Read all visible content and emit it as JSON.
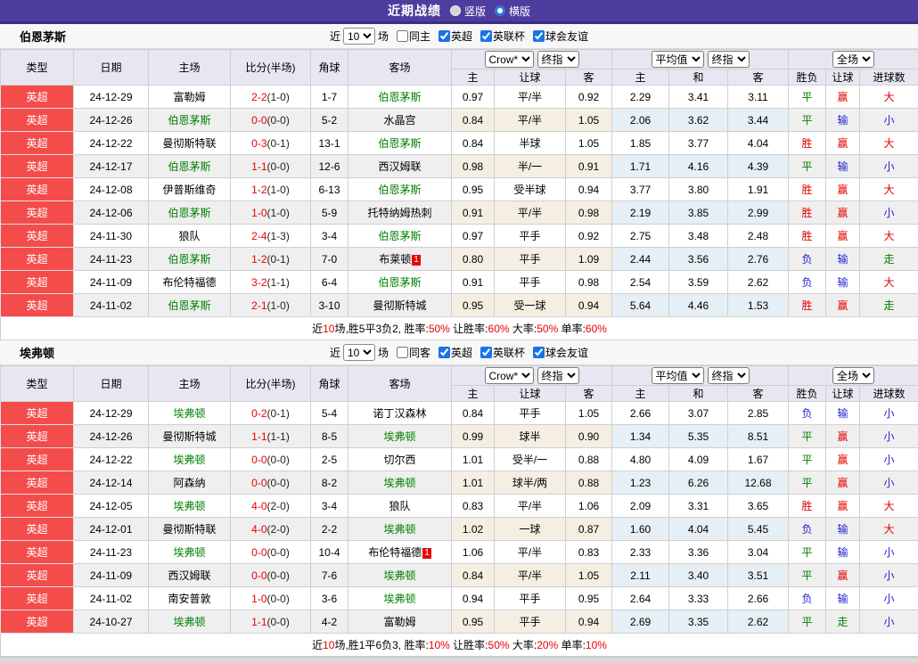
{
  "topbar": {
    "title": "近期战绩",
    "radios": [
      {
        "label": "竖版",
        "checked": false
      },
      {
        "label": "横版",
        "checked": true
      }
    ]
  },
  "table_headers": {
    "cols": [
      "类型",
      "日期",
      "主场",
      "比分(半场)",
      "角球",
      "客场"
    ],
    "odds_group": {
      "select1": "Crow*",
      "select2": "终指",
      "subcols": [
        "主",
        "让球",
        "客"
      ]
    },
    "avg_group": {
      "select1": "平均值",
      "select2": "终指",
      "subcols": [
        "主",
        "和",
        "客"
      ]
    },
    "result_group": {
      "select": "全场",
      "subcols": [
        "胜负",
        "让球",
        "进球数"
      ]
    }
  },
  "colors": {
    "win": "#e60000",
    "draw": "#008000",
    "lose": "#1f1fd0",
    "accent_purple": "#4e3d9e",
    "type_red": "#f44b4b",
    "team_green": "#008000"
  },
  "result_color_map": {
    "胜": "win",
    "平": "draw",
    "负": "lose",
    "赢": "win",
    "走": "draw",
    "输": "lose",
    "大": "win",
    "小": "lose"
  },
  "sections": [
    {
      "team": "伯恩茅斯",
      "filter": {
        "near": "近",
        "count": "10",
        "games": "场",
        "same": {
          "label": "同主",
          "checked": false
        },
        "leagues": [
          {
            "label": "英超",
            "checked": true
          },
          {
            "label": "英联杯",
            "checked": true
          },
          {
            "label": "球会友谊",
            "checked": true
          }
        ]
      },
      "rows": [
        {
          "ty": "英超",
          "dt": "24-12-29",
          "hm": "富勒姆",
          "hs": false,
          "sc": "2-2",
          "hf": "(1-0)",
          "cn": "1-7",
          "aw": "伯恩茅斯",
          "as": true,
          "ab": false,
          "o1": "0.97",
          "h": "平/半",
          "o2": "0.92",
          "a1": "2.29",
          "a2": "3.41",
          "a3": "3.11",
          "r1": "平",
          "r2": "赢",
          "r3": "大"
        },
        {
          "ty": "英超",
          "dt": "24-12-26",
          "hm": "伯恩茅斯",
          "hs": true,
          "sc": "0-0",
          "hf": "(0-0)",
          "cn": "5-2",
          "aw": "水晶宫",
          "as": false,
          "ab": false,
          "o1": "0.84",
          "h": "平/半",
          "o2": "1.05",
          "a1": "2.06",
          "a2": "3.62",
          "a3": "3.44",
          "r1": "平",
          "r2": "输",
          "r3": "小"
        },
        {
          "ty": "英超",
          "dt": "24-12-22",
          "hm": "曼彻斯特联",
          "hs": false,
          "sc": "0-3",
          "hf": "(0-1)",
          "cn": "13-1",
          "aw": "伯恩茅斯",
          "as": true,
          "ab": false,
          "o1": "0.84",
          "h": "半球",
          "o2": "1.05",
          "a1": "1.85",
          "a2": "3.77",
          "a3": "4.04",
          "r1": "胜",
          "r2": "赢",
          "r3": "大"
        },
        {
          "ty": "英超",
          "dt": "24-12-17",
          "hm": "伯恩茅斯",
          "hs": true,
          "sc": "1-1",
          "hf": "(0-0)",
          "cn": "12-6",
          "aw": "西汉姆联",
          "as": false,
          "ab": false,
          "o1": "0.98",
          "h": "半/一",
          "o2": "0.91",
          "a1": "1.71",
          "a2": "4.16",
          "a3": "4.39",
          "r1": "平",
          "r2": "输",
          "r3": "小"
        },
        {
          "ty": "英超",
          "dt": "24-12-08",
          "hm": "伊普斯维奇",
          "hs": false,
          "sc": "1-2",
          "hf": "(1-0)",
          "cn": "6-13",
          "aw": "伯恩茅斯",
          "as": true,
          "ab": false,
          "o1": "0.95",
          "h": "受半球",
          "o2": "0.94",
          "a1": "3.77",
          "a2": "3.80",
          "a3": "1.91",
          "r1": "胜",
          "r2": "赢",
          "r3": "大"
        },
        {
          "ty": "英超",
          "dt": "24-12-06",
          "hm": "伯恩茅斯",
          "hs": true,
          "sc": "1-0",
          "hf": "(1-0)",
          "cn": "5-9",
          "aw": "托特纳姆热刺",
          "as": false,
          "ab": false,
          "o1": "0.91",
          "h": "平/半",
          "o2": "0.98",
          "a1": "2.19",
          "a2": "3.85",
          "a3": "2.99",
          "r1": "胜",
          "r2": "赢",
          "r3": "小"
        },
        {
          "ty": "英超",
          "dt": "24-11-30",
          "hm": "狼队",
          "hs": false,
          "sc": "2-4",
          "hf": "(1-3)",
          "cn": "3-4",
          "aw": "伯恩茅斯",
          "as": true,
          "ab": false,
          "o1": "0.97",
          "h": "平手",
          "o2": "0.92",
          "a1": "2.75",
          "a2": "3.48",
          "a3": "2.48",
          "r1": "胜",
          "r2": "赢",
          "r3": "大"
        },
        {
          "ty": "英超",
          "dt": "24-11-23",
          "hm": "伯恩茅斯",
          "hs": true,
          "sc": "1-2",
          "hf": "(0-1)",
          "cn": "7-0",
          "aw": "布莱顿",
          "as": false,
          "ab": true,
          "o1": "0.80",
          "h": "平手",
          "o2": "1.09",
          "a1": "2.44",
          "a2": "3.56",
          "a3": "2.76",
          "r1": "负",
          "r2": "输",
          "r3": "走"
        },
        {
          "ty": "英超",
          "dt": "24-11-09",
          "hm": "布伦特福德",
          "hs": false,
          "sc": "3-2",
          "hf": "(1-1)",
          "cn": "6-4",
          "aw": "伯恩茅斯",
          "as": true,
          "ab": false,
          "o1": "0.91",
          "h": "平手",
          "o2": "0.98",
          "a1": "2.54",
          "a2": "3.59",
          "a3": "2.62",
          "r1": "负",
          "r2": "输",
          "r3": "大"
        },
        {
          "ty": "英超",
          "dt": "24-11-02",
          "hm": "伯恩茅斯",
          "hs": true,
          "sc": "2-1",
          "hf": "(1-0)",
          "cn": "3-10",
          "aw": "曼彻斯特城",
          "as": false,
          "ab": false,
          "o1": "0.95",
          "h": "受一球",
          "o2": "0.94",
          "a1": "5.64",
          "a2": "4.46",
          "a3": "1.53",
          "r1": "胜",
          "r2": "赢",
          "r3": "走"
        }
      ],
      "summary": [
        {
          "t": "近"
        },
        {
          "t": "10",
          "red": true
        },
        {
          "t": "场,胜5平3负2, 胜率:"
        },
        {
          "t": "50%",
          "red": true
        },
        {
          "t": " 让胜率:"
        },
        {
          "t": "60%",
          "red": true
        },
        {
          "t": " 大率:"
        },
        {
          "t": "50%",
          "red": true
        },
        {
          "t": " 单率:"
        },
        {
          "t": "60%",
          "red": true
        }
      ]
    },
    {
      "team": "埃弗顿",
      "filter": {
        "near": "近",
        "count": "10",
        "games": "场",
        "same": {
          "label": "同客",
          "checked": false
        },
        "leagues": [
          {
            "label": "英超",
            "checked": true
          },
          {
            "label": "英联杯",
            "checked": true
          },
          {
            "label": "球会友谊",
            "checked": true
          }
        ]
      },
      "rows": [
        {
          "ty": "英超",
          "dt": "24-12-29",
          "hm": "埃弗顿",
          "hs": true,
          "sc": "0-2",
          "hf": "(0-1)",
          "cn": "5-4",
          "aw": "诺丁汉森林",
          "as": false,
          "ab": false,
          "o1": "0.84",
          "h": "平手",
          "o2": "1.05",
          "a1": "2.66",
          "a2": "3.07",
          "a3": "2.85",
          "r1": "负",
          "r2": "输",
          "r3": "小"
        },
        {
          "ty": "英超",
          "dt": "24-12-26",
          "hm": "曼彻斯特城",
          "hs": false,
          "sc": "1-1",
          "hf": "(1-1)",
          "cn": "8-5",
          "aw": "埃弗顿",
          "as": true,
          "ab": false,
          "o1": "0.99",
          "h": "球半",
          "o2": "0.90",
          "a1": "1.34",
          "a2": "5.35",
          "a3": "8.51",
          "r1": "平",
          "r2": "赢",
          "r3": "小"
        },
        {
          "ty": "英超",
          "dt": "24-12-22",
          "hm": "埃弗顿",
          "hs": true,
          "sc": "0-0",
          "hf": "(0-0)",
          "cn": "2-5",
          "aw": "切尔西",
          "as": false,
          "ab": false,
          "o1": "1.01",
          "h": "受半/一",
          "o2": "0.88",
          "a1": "4.80",
          "a2": "4.09",
          "a3": "1.67",
          "r1": "平",
          "r2": "赢",
          "r3": "小"
        },
        {
          "ty": "英超",
          "dt": "24-12-14",
          "hm": "阿森纳",
          "hs": false,
          "sc": "0-0",
          "hf": "(0-0)",
          "cn": "8-2",
          "aw": "埃弗顿",
          "as": true,
          "ab": false,
          "o1": "1.01",
          "h": "球半/两",
          "o2": "0.88",
          "a1": "1.23",
          "a2": "6.26",
          "a3": "12.68",
          "r1": "平",
          "r2": "赢",
          "r3": "小"
        },
        {
          "ty": "英超",
          "dt": "24-12-05",
          "hm": "埃弗顿",
          "hs": true,
          "sc": "4-0",
          "hf": "(2-0)",
          "cn": "3-4",
          "aw": "狼队",
          "as": false,
          "ab": false,
          "o1": "0.83",
          "h": "平/半",
          "o2": "1.06",
          "a1": "2.09",
          "a2": "3.31",
          "a3": "3.65",
          "r1": "胜",
          "r2": "赢",
          "r3": "大"
        },
        {
          "ty": "英超",
          "dt": "24-12-01",
          "hm": "曼彻斯特联",
          "hs": false,
          "sc": "4-0",
          "hf": "(2-0)",
          "cn": "2-2",
          "aw": "埃弗顿",
          "as": true,
          "ab": false,
          "o1": "1.02",
          "h": "一球",
          "o2": "0.87",
          "a1": "1.60",
          "a2": "4.04",
          "a3": "5.45",
          "r1": "负",
          "r2": "输",
          "r3": "大"
        },
        {
          "ty": "英超",
          "dt": "24-11-23",
          "hm": "埃弗顿",
          "hs": true,
          "sc": "0-0",
          "hf": "(0-0)",
          "cn": "10-4",
          "aw": "布伦特福德",
          "as": false,
          "ab": true,
          "o1": "1.06",
          "h": "平/半",
          "o2": "0.83",
          "a1": "2.33",
          "a2": "3.36",
          "a3": "3.04",
          "r1": "平",
          "r2": "输",
          "r3": "小"
        },
        {
          "ty": "英超",
          "dt": "24-11-09",
          "hm": "西汉姆联",
          "hs": false,
          "sc": "0-0",
          "hf": "(0-0)",
          "cn": "7-6",
          "aw": "埃弗顿",
          "as": true,
          "ab": false,
          "o1": "0.84",
          "h": "平/半",
          "o2": "1.05",
          "a1": "2.11",
          "a2": "3.40",
          "a3": "3.51",
          "r1": "平",
          "r2": "赢",
          "r3": "小"
        },
        {
          "ty": "英超",
          "dt": "24-11-02",
          "hm": "南安普敦",
          "hs": false,
          "sc": "1-0",
          "hf": "(0-0)",
          "cn": "3-6",
          "aw": "埃弗顿",
          "as": true,
          "ab": false,
          "o1": "0.94",
          "h": "平手",
          "o2": "0.95",
          "a1": "2.64",
          "a2": "3.33",
          "a3": "2.66",
          "r1": "负",
          "r2": "输",
          "r3": "小"
        },
        {
          "ty": "英超",
          "dt": "24-10-27",
          "hm": "埃弗顿",
          "hs": true,
          "sc": "1-1",
          "hf": "(0-0)",
          "cn": "4-2",
          "aw": "富勒姆",
          "as": false,
          "ab": false,
          "o1": "0.95",
          "h": "平手",
          "o2": "0.94",
          "a1": "2.69",
          "a2": "3.35",
          "a3": "2.62",
          "r1": "平",
          "r2": "走",
          "r3": "小"
        }
      ],
      "summary": [
        {
          "t": "近"
        },
        {
          "t": "10",
          "red": true
        },
        {
          "t": "场,胜1平6负3, 胜率:"
        },
        {
          "t": "10%",
          "red": true
        },
        {
          "t": " 让胜率:"
        },
        {
          "t": "50%",
          "red": true
        },
        {
          "t": " 大率:"
        },
        {
          "t": "20%",
          "red": true
        },
        {
          "t": " 单率:"
        },
        {
          "t": "10%",
          "red": true
        }
      ]
    }
  ]
}
